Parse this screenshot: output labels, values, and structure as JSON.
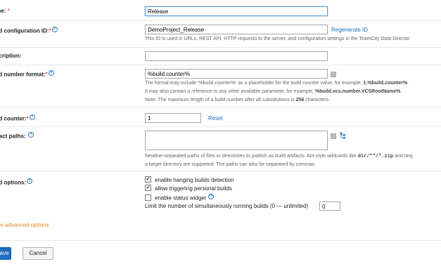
{
  "fields": {
    "name": {
      "label": "me:",
      "required": "*",
      "value": "Release"
    },
    "config_id": {
      "label": "ild configuration ID:",
      "required": "*",
      "value": "DemoProject_Release",
      "action": "Regenerate ID",
      "note": "This ID is used in URLs, REST API, HTTP requests to the server, and configuration settings in the TeamCity Data Director"
    },
    "description": {
      "label": "scription:",
      "value": ""
    },
    "build_number": {
      "label": "ild number format:",
      "required": "*",
      "value": "%build.counter%",
      "note1_a": "The format may include '%build.counter%' as a placeholder for the build counter value, for example, ",
      "note1_b": "1.%build.counter%",
      "note1_c": ".",
      "note2_a": "It may also contain a reference to any other available parameter, for example, ",
      "note2_b": "%build.vcs.number.VCSRootName%",
      "note2_c": ".",
      "note3_a": "Note: The maximum length of a build number after all substitutions is ",
      "note3_b": "256",
      "note3_c": " characters."
    },
    "build_counter": {
      "label": "ild counter:",
      "required": "*",
      "value": "1",
      "action": "Reset"
    },
    "artifact_paths": {
      "label": "ifact paths:",
      "value": "",
      "note1_a": "Newline-separated paths of files or directories to publish as build artifacts. Ant-style wildcards like ",
      "note1_b": "dir/**/*.zip",
      "note1_c": " and targ",
      "note2": "a target directory are supported. The paths can also be separated by commas."
    },
    "build_options": {
      "label": "ild options:",
      "opt1": "enable hanging builds detection",
      "opt2": "allow triggering personal builds",
      "opt3": "enable status widget",
      "limit_label": "Limit the number of simultaneously running builds (0 — unlimited)",
      "limit_value": "0"
    }
  },
  "advanced_link": "ide advanced options",
  "buttons": {
    "save": "ave",
    "cancel": "Cancel"
  },
  "check_glyph": "✔",
  "colors": {
    "link": "#1a6fc4",
    "advanced": "#e08a1e",
    "required": "#d50000",
    "primary_button": "#1f6fc1"
  }
}
